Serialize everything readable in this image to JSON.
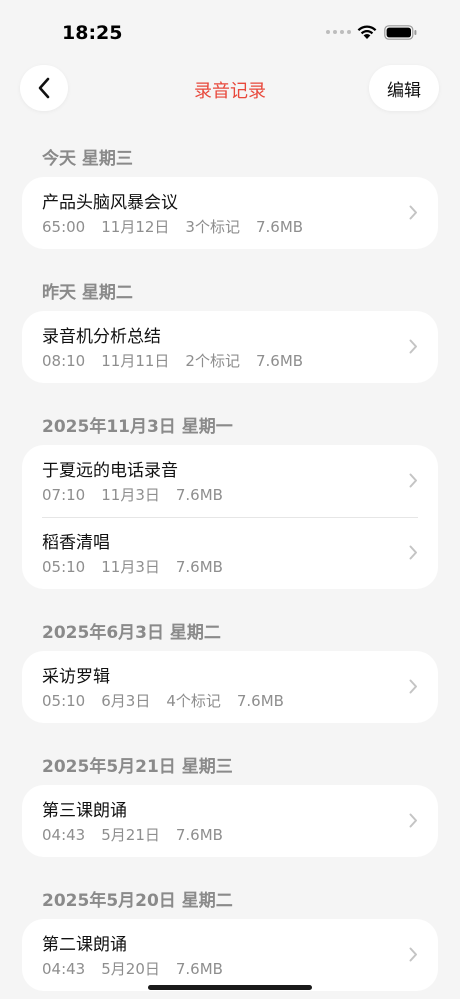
{
  "status_bar": {
    "time": "18:25"
  },
  "nav": {
    "title": "录音记录",
    "edit_label": "编辑"
  },
  "sections": [
    {
      "header": "今天 星期三",
      "items": [
        {
          "title": "产品头脑风暴会议",
          "duration": "65:00",
          "date": "11月12日",
          "marks": "3个标记",
          "size": "7.6MB"
        }
      ]
    },
    {
      "header": "昨天 星期二",
      "items": [
        {
          "title": "录音机分析总结",
          "duration": "08:10",
          "date": "11月11日",
          "marks": "2个标记",
          "size": "7.6MB"
        }
      ]
    },
    {
      "header": "2025年11月3日 星期一",
      "items": [
        {
          "title": "于夏远的电话录音",
          "duration": "07:10",
          "date": "11月3日",
          "marks": "",
          "size": "7.6MB"
        },
        {
          "title": "稻香清唱",
          "duration": "05:10",
          "date": "11月3日",
          "marks": "",
          "size": "7.6MB"
        }
      ]
    },
    {
      "header": "2025年6月3日 星期二",
      "items": [
        {
          "title": "采访罗辑",
          "duration": "05:10",
          "date": "6月3日",
          "marks": "4个标记",
          "size": "7.6MB"
        }
      ]
    },
    {
      "header": "2025年5月21日 星期三",
      "items": [
        {
          "title": "第三课朗诵",
          "duration": "04:43",
          "date": "5月21日",
          "marks": "",
          "size": "7.6MB"
        }
      ]
    },
    {
      "header": "2025年5月20日 星期二",
      "items": [
        {
          "title": "第二课朗诵",
          "duration": "04:43",
          "date": "5月20日",
          "marks": "",
          "size": "7.6MB"
        }
      ]
    }
  ],
  "colors": {
    "accent": "#e8483b",
    "background": "#f5f5f5",
    "card": "#ffffff",
    "meta_text": "#8e8e8e"
  },
  "icons": {
    "back": "chevron-left-icon",
    "row_disclosure": "chevron-right-icon"
  }
}
